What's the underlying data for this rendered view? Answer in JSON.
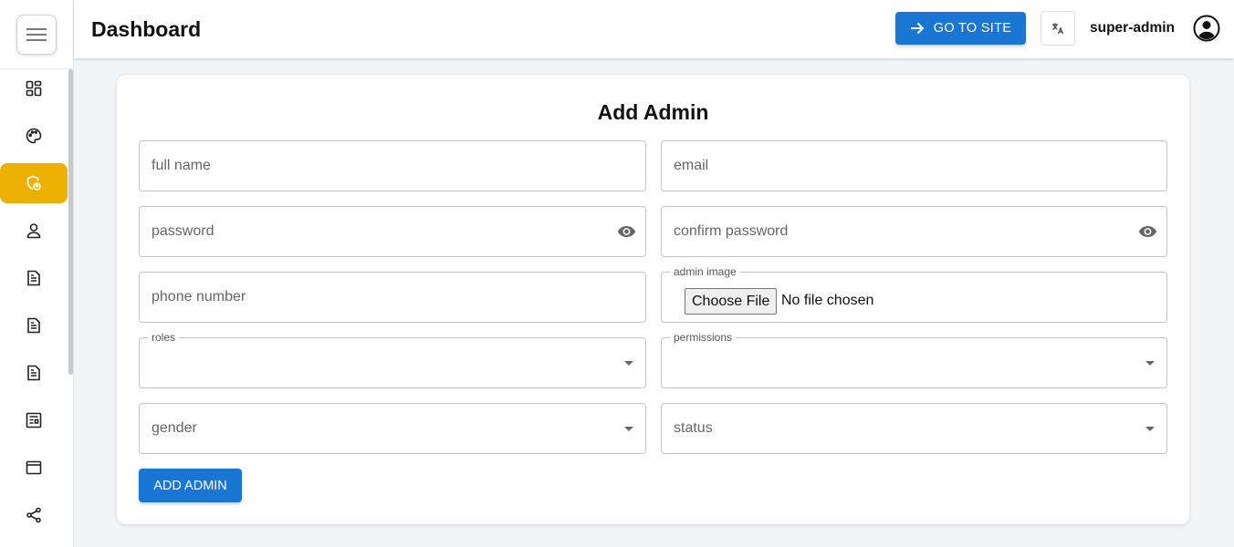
{
  "header": {
    "title": "Dashboard",
    "go_to_site_label": "GO TO SITE",
    "user_name": "super-admin"
  },
  "sidebar": {
    "items": [
      {
        "icon": "dashboard-icon",
        "active": false
      },
      {
        "icon": "palette-icon",
        "active": false
      },
      {
        "icon": "admin-shield-icon",
        "active": true
      },
      {
        "icon": "user-icon",
        "active": false
      },
      {
        "icon": "document-icon",
        "active": false
      },
      {
        "icon": "document-icon",
        "active": false
      },
      {
        "icon": "document-icon",
        "active": false
      },
      {
        "icon": "article-icon",
        "active": false
      },
      {
        "icon": "window-icon",
        "active": false
      },
      {
        "icon": "share-icon",
        "active": false
      }
    ]
  },
  "form": {
    "title": "Add Admin",
    "full_name_placeholder": "full name",
    "email_placeholder": "email",
    "password_placeholder": "password",
    "confirm_password_placeholder": "confirm password",
    "phone_placeholder": "phone number",
    "admin_image_label": "admin image",
    "choose_file_label": "Choose File",
    "no_file_text": "No file chosen",
    "roles_label": "roles",
    "permissions_label": "permissions",
    "gender_placeholder": "gender",
    "status_placeholder": "status",
    "submit_label": "ADD ADMIN"
  },
  "colors": {
    "primary": "#1976d2",
    "active_sidebar": "#ecb100",
    "background": "#f3f4f6"
  }
}
